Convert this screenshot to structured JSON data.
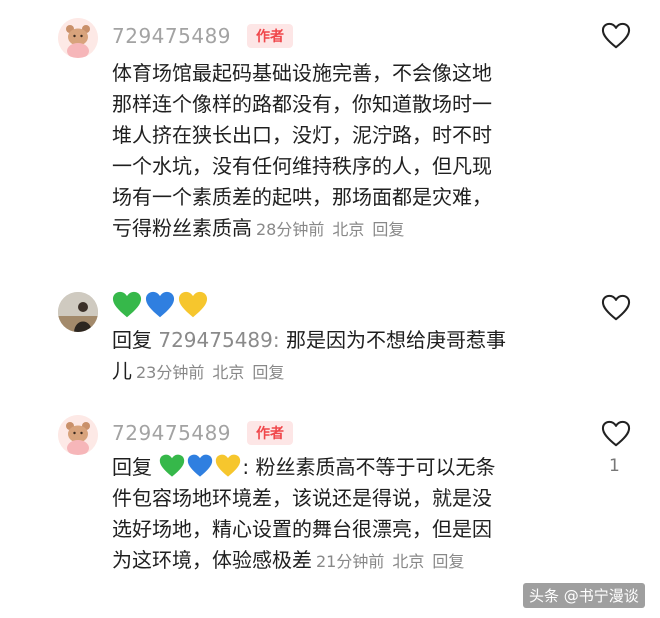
{
  "comments": [
    {
      "username": "729475489",
      "author_tag": "作者",
      "lines": [
        "体育场馆最起码基础设施完善，不会像这地",
        "那样连个像样的路都没有，你知道散场时一",
        "堆人挤在狭长出口，没灯，泥泞路，时不时",
        "一个水坑，没有任何维持秩序的人，但凡现",
        "场有一个素质差的起哄，那场面都是灾难，",
        "亏得粉丝素质高"
      ],
      "time": "28分钟前",
      "location": "北京",
      "reply_label": "回复",
      "like_icon": "heart-outline-icon"
    },
    {
      "emojis": [
        "green-heart-icon",
        "blue-heart-icon",
        "yellow-heart-icon"
      ],
      "reply_prefix": "回复",
      "reply_to": "729475489:",
      "line1": "那是因为不想给庚哥惹事",
      "line2": "儿",
      "time": "23分钟前",
      "location": "北京",
      "reply_label": "回复",
      "like_icon": "heart-outline-icon"
    },
    {
      "username": "729475489",
      "author_tag": "作者",
      "reply_prefix": "回复",
      "emojis": [
        "green-heart-icon",
        "blue-heart-icon",
        "yellow-heart-icon"
      ],
      "line1_rest": ": 粉丝素质高不等于可以无条",
      "lines": [
        "件包容场地环境差，该说还是得说，就是没",
        "选好场地，精心设置的舞台很漂亮，但是因",
        "为这环境，体验感极差"
      ],
      "time": "21分钟前",
      "location": "北京",
      "reply_label": "回复",
      "like_count": "1",
      "like_icon": "heart-outline-icon"
    }
  ],
  "watermark": "头条 @书宁漫谈",
  "colors": {
    "author_tag_bg": "#fde6e6",
    "author_tag_text": "#f0474b",
    "username": "#a3a3a3",
    "meta": "#888888"
  }
}
